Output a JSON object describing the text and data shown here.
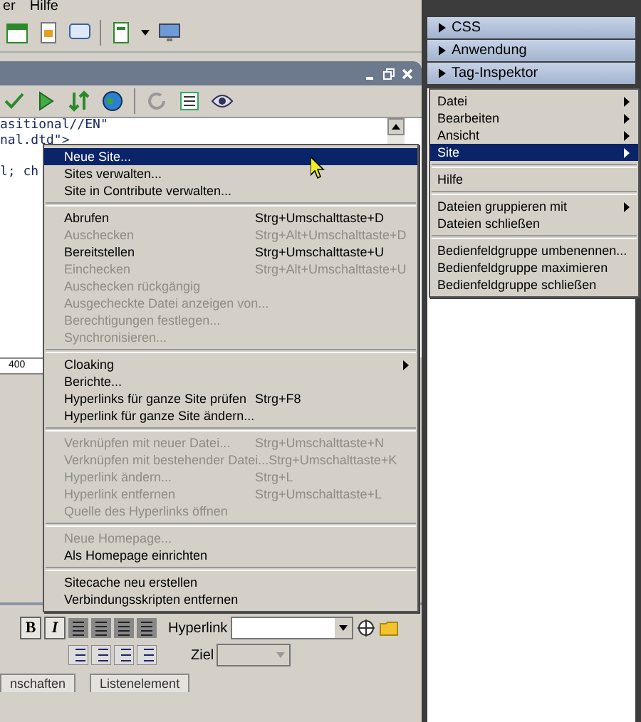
{
  "menubar": [
    "er",
    "Hilfe"
  ],
  "document": {
    "code_lines": [
      "asitional//EN\"",
      "nal.dtd\">",
      "l; ch"
    ],
    "ruler_label": "400"
  },
  "panels": [
    {
      "label": "CSS"
    },
    {
      "label": "Anwendung"
    },
    {
      "label": "Tag-Inspektor"
    }
  ],
  "site_menu": [
    {
      "kind": "item",
      "label": "Neue Site...",
      "disabled": false,
      "submenu": false,
      "selected": true
    },
    {
      "kind": "item",
      "label": "Sites verwalten...",
      "disabled": false,
      "submenu": false,
      "selected": false
    },
    {
      "kind": "item",
      "label": "Site in Contribute verwalten...",
      "disabled": false,
      "submenu": false,
      "selected": false
    },
    {
      "kind": "separator"
    },
    {
      "kind": "item",
      "label": "Abrufen",
      "shortcut": "Strg+Umschalttaste+D",
      "disabled": false,
      "submenu": false,
      "selected": false
    },
    {
      "kind": "item",
      "label": "Auschecken",
      "shortcut": "Strg+Alt+Umschalttaste+D",
      "disabled": true,
      "submenu": false,
      "selected": false
    },
    {
      "kind": "item",
      "label": "Bereitstellen",
      "shortcut": "Strg+Umschalttaste+U",
      "disabled": false,
      "submenu": false,
      "selected": false
    },
    {
      "kind": "item",
      "label": "Einchecken",
      "shortcut": "Strg+Alt+Umschalttaste+U",
      "disabled": true,
      "submenu": false,
      "selected": false
    },
    {
      "kind": "item",
      "label": "Auschecken rückgängig",
      "disabled": true,
      "submenu": false,
      "selected": false
    },
    {
      "kind": "item",
      "label": "Ausgecheckte Datei anzeigen von...",
      "disabled": true,
      "submenu": false,
      "selected": false
    },
    {
      "kind": "item",
      "label": "Berechtigungen festlegen...",
      "disabled": true,
      "submenu": false,
      "selected": false
    },
    {
      "kind": "item",
      "label": "Synchronisieren...",
      "disabled": true,
      "submenu": false,
      "selected": false
    },
    {
      "kind": "separator"
    },
    {
      "kind": "item",
      "label": "Cloaking",
      "disabled": false,
      "submenu": true,
      "selected": false
    },
    {
      "kind": "item",
      "label": "Berichte...",
      "disabled": false,
      "submenu": false,
      "selected": false
    },
    {
      "kind": "item",
      "label": "Hyperlinks für ganze Site prüfen",
      "shortcut": "Strg+F8",
      "disabled": false,
      "submenu": false,
      "selected": false
    },
    {
      "kind": "item",
      "label": "Hyperlink für ganze Site ändern...",
      "disabled": false,
      "submenu": false,
      "selected": false
    },
    {
      "kind": "separator"
    },
    {
      "kind": "item",
      "label": "Verknüpfen mit neuer Datei...",
      "shortcut": "Strg+Umschalttaste+N",
      "disabled": true,
      "submenu": false,
      "selected": false
    },
    {
      "kind": "item",
      "label": "Verknüpfen mit bestehender Datei...",
      "shortcut": "Strg+Umschalttaste+K",
      "disabled": true,
      "submenu": false,
      "selected": false
    },
    {
      "kind": "item",
      "label": "Hyperlink ändern...",
      "shortcut": "Strg+L",
      "disabled": true,
      "submenu": false,
      "selected": false
    },
    {
      "kind": "item",
      "label": "Hyperlink entfernen",
      "shortcut": "Strg+Umschalttaste+L",
      "disabled": true,
      "submenu": false,
      "selected": false
    },
    {
      "kind": "item",
      "label": "Quelle des Hyperlinks öffnen",
      "disabled": true,
      "submenu": false,
      "selected": false
    },
    {
      "kind": "separator"
    },
    {
      "kind": "item",
      "label": "Neue Homepage...",
      "disabled": true,
      "submenu": false,
      "selected": false
    },
    {
      "kind": "item",
      "label": "Als Homepage einrichten",
      "disabled": false,
      "submenu": false,
      "selected": false
    },
    {
      "kind": "separator"
    },
    {
      "kind": "item",
      "label": "Sitecache neu erstellen",
      "disabled": false,
      "submenu": false,
      "selected": false
    },
    {
      "kind": "item",
      "label": "Verbindungsskripten entfernen",
      "disabled": false,
      "submenu": false,
      "selected": false
    }
  ],
  "panel_menu": [
    {
      "kind": "item",
      "label": "Datei",
      "submenu": true,
      "selected": false
    },
    {
      "kind": "item",
      "label": "Bearbeiten",
      "submenu": true,
      "selected": false
    },
    {
      "kind": "item",
      "label": "Ansicht",
      "submenu": true,
      "selected": false
    },
    {
      "kind": "item",
      "label": "Site",
      "submenu": true,
      "selected": true
    },
    {
      "kind": "separator"
    },
    {
      "kind": "item",
      "label": "Hilfe",
      "submenu": false,
      "selected": false
    },
    {
      "kind": "separator"
    },
    {
      "kind": "item",
      "label": "Dateien gruppieren mit",
      "submenu": true,
      "selected": false
    },
    {
      "kind": "item",
      "label": "Dateien schließen",
      "submenu": false,
      "selected": false
    },
    {
      "kind": "separator"
    },
    {
      "kind": "item",
      "label": "Bedienfeldgruppe umbenennen...",
      "submenu": false,
      "selected": false
    },
    {
      "kind": "item",
      "label": "Bedienfeldgruppe maximieren",
      "submenu": false,
      "selected": false
    },
    {
      "kind": "item",
      "label": "Bedienfeldgruppe schließen",
      "submenu": false,
      "selected": false
    }
  ],
  "properties": {
    "hyperlink_label": "Hyperlink",
    "target_label": "Ziel",
    "bold": "B",
    "italic": "I",
    "tabs": [
      "nschaften",
      "Listenelement"
    ]
  }
}
